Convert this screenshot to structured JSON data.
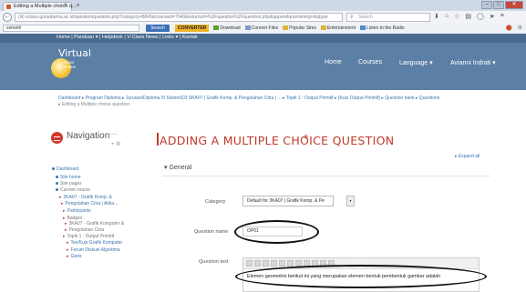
{
  "browser": {
    "tab_title": "Editing a Multiple choice q...",
    "tab_close": "×",
    "newtab": "+",
    "url": "(iii) vclass.gunadarma.ac.id/question/question.php?category=8845&courseid=7640&returnurl=%2Fquestion%2Fquestion.php&appendqnumstring=&qtype=multichoice",
    "search_placeholder": "Search",
    "win_min": "–",
    "win_max": "□",
    "win_close": "✕"
  },
  "bookmarks": {
    "search_value": "sometri",
    "search_button": "Search",
    "items": [
      "CONVERTER",
      "Download",
      "Convert Files",
      "Popular Sites",
      "Entertainment",
      "Listen to the Radio"
    ]
  },
  "moodle": {
    "top_links": "Home | Panduan ▾ | Helpdesk | V-Class News | Links ▾ | Kontak",
    "logo": "Virtual",
    "logo_sub1": "Class",
    "logo_sub2": "Online",
    "nav": [
      "Home",
      "Courses",
      "Language ▾",
      "Avianni Indrati ▾"
    ]
  },
  "breadcrumb": {
    "line1": "Dashboard ▸ Program Diploma ▸ Jurusan/Diploma III Sistem/D3 SKA07 | Grafik Komp. & Pengolahan Citra | ... ▸ Topik 1 : Output Primitif ▸ (Kuis Output Primitif) ▸ Question bank ▸ Questions",
    "line2": "▸ Editing a Multiple choice question"
  },
  "nav_block": {
    "title": "Navigation",
    "ctl1": "−−−",
    "ctl2": "+ ⚙",
    "items": [
      {
        "text": "Dashboard",
        "style": "link",
        "indent": 0
      },
      {
        "text": "Site home",
        "style": "link",
        "indent": 1
      },
      {
        "text": "Site pages",
        "style": "dim",
        "indent": 1
      },
      {
        "text": "Current course",
        "style": "dim",
        "indent": 1
      },
      {
        "text": "3KA07 - Grafik Komp. &",
        "style": "link",
        "indent": 2
      },
      {
        "text": "Pengolahan Citra | Atika...",
        "style": "link",
        "indent": 2
      },
      {
        "text": "Participants",
        "style": "link",
        "indent": 3
      },
      {
        "text": "Badges",
        "style": "dim",
        "indent": 3
      },
      {
        "text": "3KA07 - Grafik Komputer &",
        "style": "dim",
        "indent": 3
      },
      {
        "text": "Pengolahan Citra",
        "style": "dim",
        "indent": 3
      },
      {
        "text": "Topik 1 : Output Primitif",
        "style": "dim",
        "indent": 3
      },
      {
        "text": "Tes/Kuis Grafik Komputer",
        "style": "link",
        "indent": 4
      },
      {
        "text": "Forum Diskusi Algoritma",
        "style": "link",
        "indent": 4
      },
      {
        "text": "Garis",
        "style": "link",
        "indent": 4
      }
    ]
  },
  "main": {
    "title": "ADDING A MULTIPLE CHOICE QUESTION",
    "title_icon": "⊕",
    "expand_all": "▸ Expand all",
    "section": "▾ General",
    "category_label": "Category",
    "category_value": "Default for 3KA07 | Grafik Komp. & Pe",
    "category_btn": "▾",
    "qname_label": "Question name",
    "qname_value": "OP01",
    "qtext_label": "Question text",
    "qtext_value": "Elemen geometris berikut ini yang merupakan elemen bentuk pembentuk gambar adalah"
  }
}
